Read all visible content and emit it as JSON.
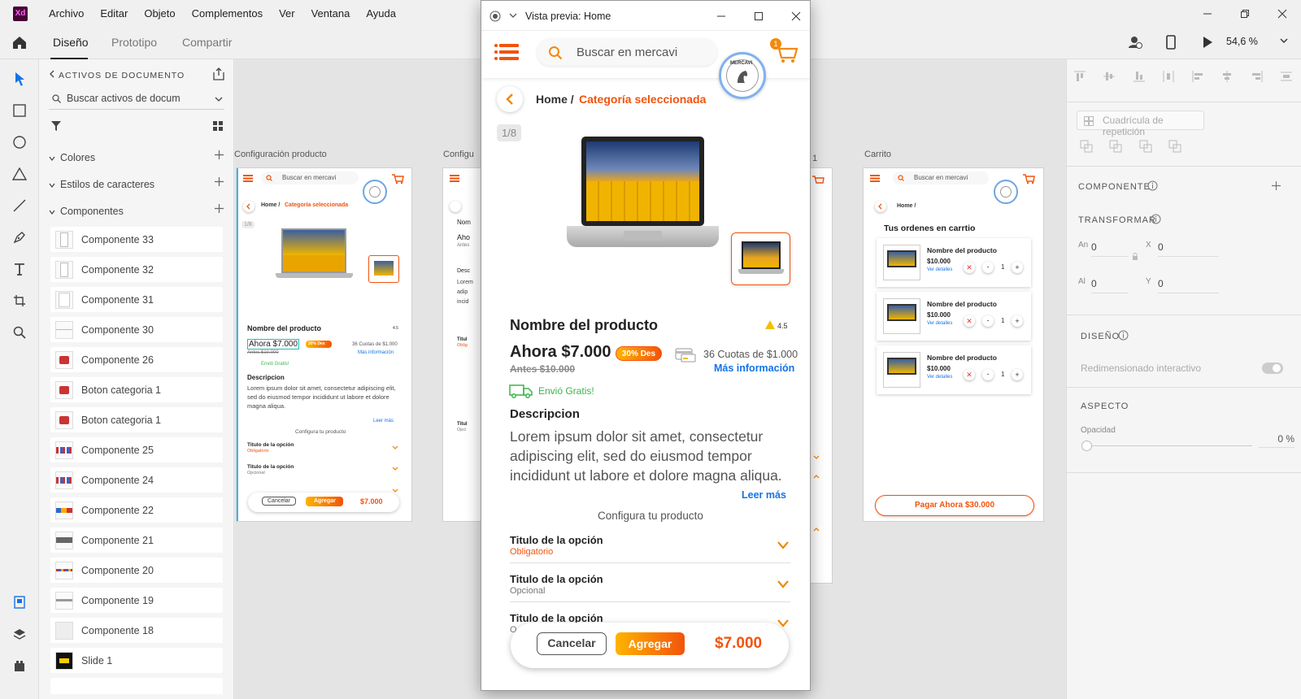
{
  "app": {
    "logo_text": "Xd",
    "menu": [
      "Archivo",
      "Editar",
      "Objeto",
      "Complementos",
      "Ver",
      "Ventana",
      "Ayuda"
    ],
    "modes": [
      "Diseño",
      "Prototipo",
      "Compartir"
    ],
    "zoom": "54,6 %"
  },
  "assets": {
    "header": "ACTIVOS DE DOCUMENTO",
    "search_placeholder": "Buscar activos de docum",
    "sections": [
      "Colores",
      "Estilos de caracteres",
      "Componentes"
    ],
    "components": [
      "Componente 33",
      "Componente 32",
      "Componente 31",
      "Componente 30",
      "Componente 26",
      "Boton categoria 1",
      "Boton categoria 1",
      "Componente 25",
      "Componente 24",
      "Componente 22",
      "Componente 21",
      "Componente 20",
      "Componente 19",
      "Componente 18",
      "Slide 1"
    ]
  },
  "canvas": {
    "artboard1_label": "Configuración producto",
    "artboard2_label": "Configu",
    "artboard3_label": "1",
    "artboard4_label": "Carrito"
  },
  "props": {
    "repeat_grid": "Cuadrícula de repetición",
    "componente": "COMPONENTE",
    "transformar": "TRANSFORMAR",
    "an_label": "An",
    "an_value": "0",
    "x_label": "X",
    "x_value": "0",
    "al_label": "Al",
    "al_value": "0",
    "y_label": "Y",
    "y_value": "0",
    "diseno": "DISEÑO",
    "redim": "Redimensionado interactivo",
    "aspecto": "ASPECTO",
    "opacidad": "Opacidad",
    "opacidad_value": "0 %"
  },
  "preview": {
    "title": "Vista previa: Home",
    "search_placeholder": "Buscar en mercavi",
    "cart_badge": "1",
    "logo_text": "MERCAVI",
    "breadcrumb_home": "Home /",
    "breadcrumb_category": "Categoría seleccionada",
    "image_counter": "1/8",
    "product_name": "Nombre del producto",
    "rating": "4.5",
    "price_now": "Ahora $7.000",
    "discount_badge": "30% Des",
    "price_before": "Antes $10.000",
    "installments": "36 Cuotas de $1.000",
    "more_info": "Más información",
    "shipping": "Envió Gratis!",
    "description_title": "Descripcion",
    "description_text": "Lorem ipsum dolor sit amet, consectetur adipiscing elit, sed do eiusmod tempor incididunt ut labore et dolore magna aliqua.",
    "read_more": "Leer más",
    "configure": "Configura tu producto",
    "options": [
      {
        "title": "Titulo de la opción",
        "sub": "Obligatorio"
      },
      {
        "title": "Titulo de la opción",
        "sub": "Opcional"
      },
      {
        "title": "Titulo de la opción",
        "sub": "O"
      }
    ],
    "cancel": "Cancelar",
    "add": "Agregar",
    "total": "$7.000"
  },
  "cart": {
    "search_placeholder": "Buscar en mercavi",
    "breadcrumb": "Home /",
    "title": "Tus ordenes en carrtio",
    "items": [
      {
        "name": "Nombre del producto",
        "price": "$10.000",
        "link": "Ver detalles",
        "qty": "1"
      },
      {
        "name": "Nombre del producto",
        "price": "$10.000",
        "link": "Ver detalles",
        "qty": "1"
      },
      {
        "name": "Nombre del producto",
        "price": "$10.000",
        "link": "Ver detalles",
        "qty": "1"
      }
    ],
    "pay": "Pagar Ahora $30.000"
  },
  "mini": {
    "search_placeholder": "Buscar en mercavi",
    "breadcrumb_home": "Home /",
    "breadcrumb_category": "Categoría seleccionada",
    "counter": "1/8",
    "product_name": "Nombre del producto",
    "rating": "4.5",
    "price_now": "Ahora $7.000",
    "discount": "30% Des",
    "before": "Antes $10.000",
    "installments": "36 Cuotas de $1.000",
    "more_info": "Más información",
    "shipping": "Envió Gratis!",
    "desc_title": "Descripcion",
    "desc": "Lorem ipsum dolor sit amet, consectetur adipiscing elit, sed do eiusmod tempor incididunt ut labore et dolore magna aliqua.",
    "read_more": "Leer más",
    "configure": "Configura tu producto",
    "opt_title": "Titulo de la opción",
    "opt_req": "Obligatorio",
    "opt_opt": "Opcional",
    "cancel": "Cancelar",
    "add": "Agregar",
    "total": "$7.000"
  },
  "artboard2": {
    "nom": "Nom",
    "aho": "Aho",
    "ant": "Antes",
    "desc": "Desc",
    "lorem": "Lorem",
    "adip": "adip",
    "incid": "incid",
    "titul": "Titul",
    "oblig": "Oblig",
    "titul2": "Titul",
    "opci": "Opci"
  }
}
